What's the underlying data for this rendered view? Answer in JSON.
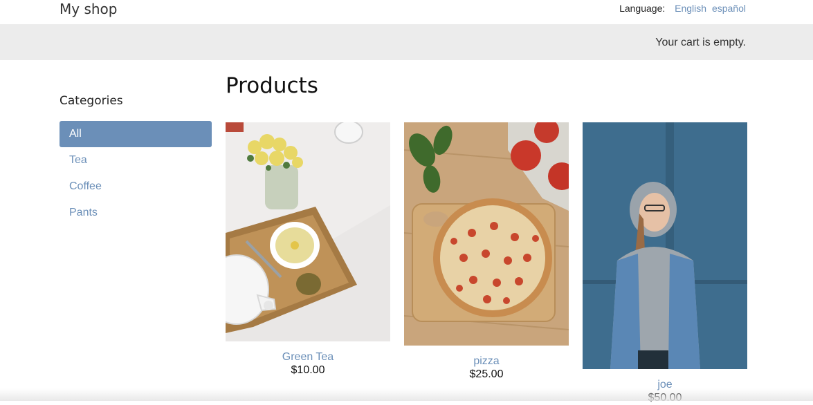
{
  "header": {
    "site_title": "My shop",
    "language_label": "Language:",
    "languages": [
      "English",
      "español"
    ]
  },
  "cart": {
    "status": "Your cart is empty."
  },
  "sidebar": {
    "title": "Categories",
    "items": [
      {
        "label": "All",
        "active": true
      },
      {
        "label": "Tea",
        "active": false
      },
      {
        "label": "Coffee",
        "active": false
      },
      {
        "label": "Pants",
        "active": false
      }
    ]
  },
  "main": {
    "title": "Products",
    "products": [
      {
        "name": "Green Tea",
        "price": "$10.00",
        "image": "tea-tray-photo"
      },
      {
        "name": "pizza",
        "price": "$25.00",
        "image": "pizza-board-photo"
      },
      {
        "name": "joe",
        "price": "$50.00",
        "image": "person-denim-jacket-photo"
      }
    ]
  },
  "colors": {
    "link": "#6b8fb8",
    "active_bg": "#6b8fb8",
    "cart_bar_bg": "#ececec"
  }
}
